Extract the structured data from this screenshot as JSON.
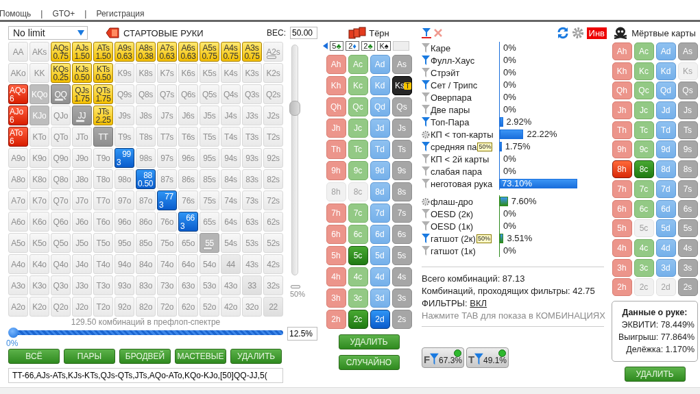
{
  "menu": [
    {
      "kind": "item",
      "label": "Помощь"
    },
    {
      "kind": "separator",
      "label": "|"
    },
    {
      "kind": "item",
      "label": "GTO+"
    },
    {
      "kind": "separator",
      "label": "|"
    },
    {
      "kind": "item",
      "label": "Регистрация"
    }
  ],
  "range_panel": {
    "game_select": "No limit",
    "title": "СТАРТОВЫЕ РУКИ",
    "weight_label": "ВЕС:",
    "weight_value": "50.00",
    "grid": [
      [
        {
          "label": "AA",
          "kind": "none",
          "partial": false
        },
        {
          "label": "AKs",
          "kind": "none",
          "partial": false
        },
        {
          "label": "AQs",
          "weight": "0.75",
          "kind": "gold",
          "partial": false
        },
        {
          "label": "AJs",
          "weight": "1.50",
          "kind": "gold",
          "partial": false
        },
        {
          "label": "ATs",
          "weight": "1.50",
          "kind": "gold",
          "partial": false
        },
        {
          "label": "A9s",
          "weight": "0.63",
          "kind": "gold",
          "partial": false
        },
        {
          "label": "A8s",
          "weight": "0.38",
          "kind": "gold",
          "partial": false
        },
        {
          "label": "A7s",
          "weight": "0.63",
          "kind": "gold",
          "partial": false
        },
        {
          "label": "A6s",
          "weight": "0.63",
          "kind": "gold",
          "partial": false
        },
        {
          "label": "A5s",
          "weight": "0.75",
          "kind": "gold",
          "partial": false
        },
        {
          "label": "A4s",
          "weight": "0.75",
          "kind": "gold",
          "partial": false
        },
        {
          "label": "A3s",
          "weight": "0.75",
          "kind": "gold",
          "partial": false
        },
        {
          "label": "A2s",
          "kind": "none",
          "partial": true
        }
      ],
      [
        {
          "label": "AKo",
          "kind": "none",
          "partial": false
        },
        {
          "label": "KK",
          "kind": "none",
          "partial": false
        },
        {
          "label": "KQs",
          "weight": "0.25",
          "kind": "gold",
          "partial": false
        },
        {
          "label": "KJs",
          "weight": "0.50",
          "kind": "gold",
          "partial": false
        },
        {
          "label": "KTs",
          "weight": "0.50",
          "kind": "gold",
          "partial": false
        },
        {
          "label": "K9s",
          "kind": "none",
          "partial": false
        },
        {
          "label": "K8s",
          "kind": "none",
          "partial": false
        },
        {
          "label": "K7s",
          "kind": "none",
          "partial": false
        },
        {
          "label": "K6s",
          "kind": "none",
          "partial": false
        },
        {
          "label": "K5s",
          "kind": "none",
          "partial": false
        },
        {
          "label": "K4s",
          "kind": "none",
          "partial": false
        },
        {
          "label": "K3s",
          "kind": "none",
          "partial": false
        },
        {
          "label": "K2s",
          "kind": "none",
          "partial": false
        }
      ],
      [
        {
          "label": "AQo",
          "weight": "6",
          "kind": "red",
          "partial": false
        },
        {
          "label": "KQo",
          "kind": "grey",
          "partial": false
        },
        {
          "label": "QQ",
          "kind": "dark",
          "partial": true
        },
        {
          "label": "QJs",
          "weight": "1.75",
          "kind": "gold",
          "partial": false
        },
        {
          "label": "QTs",
          "weight": "1.75",
          "kind": "gold",
          "partial": false
        },
        {
          "label": "Q9s",
          "kind": "none",
          "partial": false
        },
        {
          "label": "Q8s",
          "kind": "none",
          "partial": false
        },
        {
          "label": "Q7s",
          "kind": "none",
          "partial": false
        },
        {
          "label": "Q6s",
          "kind": "none",
          "partial": false
        },
        {
          "label": "Q5s",
          "kind": "none",
          "partial": false
        },
        {
          "label": "Q4s",
          "kind": "none",
          "partial": false
        },
        {
          "label": "Q3s",
          "kind": "none",
          "partial": false
        },
        {
          "label": "Q2s",
          "kind": "none",
          "partial": false
        }
      ],
      [
        {
          "label": "AJo",
          "weight": "6",
          "kind": "red",
          "partial": false
        },
        {
          "label": "KJo",
          "kind": "grey",
          "partial": false
        },
        {
          "label": "QJo",
          "kind": "none",
          "partial": false
        },
        {
          "label": "JJ",
          "kind": "dark",
          "partial": true
        },
        {
          "label": "JTs",
          "weight": "2.25",
          "kind": "gold",
          "partial": false
        },
        {
          "label": "J9s",
          "kind": "none",
          "partial": false
        },
        {
          "label": "J8s",
          "kind": "none",
          "partial": false
        },
        {
          "label": "J7s",
          "kind": "none",
          "partial": false
        },
        {
          "label": "J6s",
          "kind": "none",
          "partial": false
        },
        {
          "label": "J5s",
          "kind": "none",
          "partial": false
        },
        {
          "label": "J4s",
          "kind": "none",
          "partial": false
        },
        {
          "label": "J3s",
          "kind": "none",
          "partial": false
        },
        {
          "label": "J2s",
          "kind": "none",
          "partial": false
        }
      ],
      [
        {
          "label": "ATo",
          "weight": "6",
          "kind": "red",
          "partial": false
        },
        {
          "label": "KTo",
          "kind": "none",
          "partial": false
        },
        {
          "label": "QTo",
          "kind": "none",
          "partial": false
        },
        {
          "label": "JTo",
          "kind": "none",
          "partial": false
        },
        {
          "label": "TT",
          "kind": "dark",
          "partial": false
        },
        {
          "label": "T9s",
          "kind": "none",
          "partial": false
        },
        {
          "label": "T8s",
          "kind": "none",
          "partial": false
        },
        {
          "label": "T7s",
          "kind": "none",
          "partial": false
        },
        {
          "label": "T6s",
          "kind": "none",
          "partial": false
        },
        {
          "label": "T5s",
          "kind": "none",
          "partial": false
        },
        {
          "label": "T4s",
          "kind": "none",
          "partial": false
        },
        {
          "label": "T3s",
          "kind": "none",
          "partial": false
        },
        {
          "label": "T2s",
          "kind": "none",
          "partial": false
        }
      ],
      [
        {
          "label": "A9o",
          "kind": "none",
          "partial": false
        },
        {
          "label": "K9o",
          "kind": "none",
          "partial": false
        },
        {
          "label": "Q9o",
          "kind": "none",
          "partial": false
        },
        {
          "label": "J9o",
          "kind": "none",
          "partial": false
        },
        {
          "label": "T9o",
          "kind": "none",
          "partial": false
        },
        {
          "label": "99",
          "weight": "3",
          "kind": "blue",
          "partial": false
        },
        {
          "label": "98s",
          "kind": "none",
          "partial": false
        },
        {
          "label": "97s",
          "kind": "none",
          "partial": false
        },
        {
          "label": "96s",
          "kind": "none",
          "partial": false
        },
        {
          "label": "95s",
          "kind": "none",
          "partial": false
        },
        {
          "label": "94s",
          "kind": "none",
          "partial": false
        },
        {
          "label": "93s",
          "kind": "none",
          "partial": false
        },
        {
          "label": "92s",
          "kind": "none",
          "partial": false
        }
      ],
      [
        {
          "label": "A8o",
          "kind": "none",
          "partial": false
        },
        {
          "label": "K8o",
          "kind": "none",
          "partial": false
        },
        {
          "label": "Q8o",
          "kind": "none",
          "partial": false
        },
        {
          "label": "J8o",
          "kind": "none",
          "partial": false
        },
        {
          "label": "T8o",
          "kind": "none",
          "partial": false
        },
        {
          "label": "98o",
          "kind": "none",
          "partial": false
        },
        {
          "label": "88",
          "weight": "0.50",
          "kind": "blue",
          "partial": false
        },
        {
          "label": "87s",
          "kind": "none",
          "partial": false
        },
        {
          "label": "86s",
          "kind": "none",
          "partial": false
        },
        {
          "label": "85s",
          "kind": "none",
          "partial": false
        },
        {
          "label": "84s",
          "kind": "none",
          "partial": false
        },
        {
          "label": "83s",
          "kind": "none",
          "partial": false
        },
        {
          "label": "82s",
          "kind": "none",
          "partial": false
        }
      ],
      [
        {
          "label": "A7o",
          "kind": "none",
          "partial": false
        },
        {
          "label": "K7o",
          "kind": "none",
          "partial": false
        },
        {
          "label": "Q7o",
          "kind": "none",
          "partial": false
        },
        {
          "label": "J7o",
          "kind": "none",
          "partial": false
        },
        {
          "label": "T7o",
          "kind": "none",
          "partial": false
        },
        {
          "label": "97o",
          "kind": "none",
          "partial": false
        },
        {
          "label": "87o",
          "kind": "none",
          "partial": false
        },
        {
          "label": "77",
          "weight": "3",
          "kind": "blue",
          "partial": false
        },
        {
          "label": "76s",
          "kind": "none",
          "partial": false
        },
        {
          "label": "75s",
          "kind": "none",
          "partial": false
        },
        {
          "label": "74s",
          "kind": "none",
          "partial": false
        },
        {
          "label": "73s",
          "kind": "none",
          "partial": false
        },
        {
          "label": "72s",
          "kind": "none",
          "partial": false
        }
      ],
      [
        {
          "label": "A6o",
          "kind": "none",
          "partial": false
        },
        {
          "label": "K6o",
          "kind": "none",
          "partial": false
        },
        {
          "label": "Q6o",
          "kind": "none",
          "partial": false
        },
        {
          "label": "J6o",
          "kind": "none",
          "partial": false
        },
        {
          "label": "T6o",
          "kind": "none",
          "partial": false
        },
        {
          "label": "96o",
          "kind": "none",
          "partial": false
        },
        {
          "label": "86o",
          "kind": "none",
          "partial": false
        },
        {
          "label": "76o",
          "kind": "none",
          "partial": false
        },
        {
          "label": "66",
          "weight": "3",
          "kind": "blue",
          "partial": false
        },
        {
          "label": "65s",
          "kind": "none",
          "partial": false
        },
        {
          "label": "64s",
          "kind": "none",
          "partial": false
        },
        {
          "label": "63s",
          "kind": "none",
          "partial": false
        },
        {
          "label": "62s",
          "kind": "none",
          "partial": false
        }
      ],
      [
        {
          "label": "A5o",
          "kind": "none",
          "partial": false
        },
        {
          "label": "K5o",
          "kind": "none",
          "partial": false
        },
        {
          "label": "Q5o",
          "kind": "none",
          "partial": false
        },
        {
          "label": "J5o",
          "kind": "none",
          "partial": false
        },
        {
          "label": "T5o",
          "kind": "none",
          "partial": false
        },
        {
          "label": "95o",
          "kind": "none",
          "partial": false
        },
        {
          "label": "85o",
          "kind": "none",
          "partial": false
        },
        {
          "label": "75o",
          "kind": "none",
          "partial": false
        },
        {
          "label": "65o",
          "kind": "none",
          "partial": false
        },
        {
          "label": "55",
          "kind": "light",
          "partial": true
        },
        {
          "label": "54s",
          "kind": "none",
          "partial": false
        },
        {
          "label": "53s",
          "kind": "none",
          "partial": false
        },
        {
          "label": "52s",
          "kind": "none",
          "partial": false
        }
      ],
      [
        {
          "label": "A4o",
          "kind": "none",
          "partial": false
        },
        {
          "label": "K4o",
          "kind": "none",
          "partial": false
        },
        {
          "label": "Q4o",
          "kind": "none",
          "partial": false
        },
        {
          "label": "J4o",
          "kind": "none",
          "partial": false
        },
        {
          "label": "T4o",
          "kind": "none",
          "partial": false
        },
        {
          "label": "94o",
          "kind": "none",
          "partial": false
        },
        {
          "label": "84o",
          "kind": "none",
          "partial": false
        },
        {
          "label": "74o",
          "kind": "none",
          "partial": false
        },
        {
          "label": "64o",
          "kind": "none",
          "partial": false
        },
        {
          "label": "54o",
          "kind": "none",
          "partial": false
        },
        {
          "label": "44",
          "kind": "pair",
          "partial": false
        },
        {
          "label": "43s",
          "kind": "none",
          "partial": false
        },
        {
          "label": "42s",
          "kind": "none",
          "partial": false
        }
      ],
      [
        {
          "label": "A3o",
          "kind": "none",
          "partial": false
        },
        {
          "label": "K3o",
          "kind": "none",
          "partial": false
        },
        {
          "label": "Q3o",
          "kind": "none",
          "partial": false
        },
        {
          "label": "J3o",
          "kind": "none",
          "partial": false
        },
        {
          "label": "T3o",
          "kind": "none",
          "partial": false
        },
        {
          "label": "93o",
          "kind": "none",
          "partial": false
        },
        {
          "label": "83o",
          "kind": "none",
          "partial": false
        },
        {
          "label": "73o",
          "kind": "none",
          "partial": false
        },
        {
          "label": "63o",
          "kind": "none",
          "partial": false
        },
        {
          "label": "53o",
          "kind": "none",
          "partial": false
        },
        {
          "label": "43o",
          "kind": "none",
          "partial": false
        },
        {
          "label": "33",
          "kind": "pair",
          "partial": false
        },
        {
          "label": "32s",
          "kind": "none",
          "partial": false
        }
      ],
      [
        {
          "label": "A2o",
          "kind": "none",
          "partial": false
        },
        {
          "label": "K2o",
          "kind": "none",
          "partial": false
        },
        {
          "label": "Q2o",
          "kind": "none",
          "partial": false
        },
        {
          "label": "J2o",
          "kind": "none",
          "partial": false
        },
        {
          "label": "T2o",
          "kind": "none",
          "partial": false
        },
        {
          "label": "92o",
          "kind": "none",
          "partial": false
        },
        {
          "label": "82o",
          "kind": "none",
          "partial": false
        },
        {
          "label": "72o",
          "kind": "none",
          "partial": false
        },
        {
          "label": "62o",
          "kind": "none",
          "partial": false
        },
        {
          "label": "52o",
          "kind": "none",
          "partial": false
        },
        {
          "label": "42o",
          "kind": "none",
          "partial": false
        },
        {
          "label": "32o",
          "kind": "none",
          "partial": false
        },
        {
          "label": "22",
          "kind": "pair",
          "partial": false
        }
      ]
    ],
    "weight_slider": {
      "level": 0.72,
      "mark_label": "50%"
    },
    "combos_caption": "129.50 комбинаций в префлоп-спектре",
    "range_slider": {
      "level": 0,
      "min_label": "0%"
    },
    "percent_value": "12.5%",
    "buttons": [
      "ВСЁ",
      "ПАРЫ",
      "БРОДВЕЙ",
      "МАСТЕВЫЕ",
      "УДАЛИТЬ"
    ],
    "range_text": "TT-66,AJs-ATs,KJs-KTs,QJs-QTs,JTs,AQo-ATo,KQo-KJo,[50]QQ-JJ,5("
  },
  "board_panel": {
    "title": "Тёрн",
    "board": [
      {
        "kind": "c",
        "rank": "5",
        "suit": "♣"
      },
      {
        "kind": "d",
        "rank": "2",
        "suit": "♦"
      },
      {
        "kind": "c",
        "rank": "2",
        "suit": "♣"
      },
      {
        "kind": "s",
        "rank": "K",
        "suit": "♠"
      },
      {
        "kind": "empty"
      }
    ],
    "cards": [
      {
        "label": "Ah",
        "kind": "h",
        "selected": false,
        "disabled": false
      },
      {
        "label": "Ac",
        "kind": "c",
        "selected": false,
        "disabled": false
      },
      {
        "label": "Ad",
        "kind": "d",
        "selected": false,
        "disabled": false
      },
      {
        "label": "As",
        "kind": "s",
        "selected": false,
        "disabled": false
      },
      {
        "label": "Kh",
        "kind": "h",
        "selected": false,
        "disabled": false
      },
      {
        "label": "Kc",
        "kind": "c",
        "selected": false,
        "disabled": false
      },
      {
        "label": "Kd",
        "kind": "d",
        "selected": false,
        "disabled": false
      },
      {
        "label": "Ks",
        "kind": "s",
        "selected": true,
        "disabled": false,
        "badge": "T"
      },
      {
        "label": "Qh",
        "kind": "h",
        "selected": false,
        "disabled": false
      },
      {
        "label": "Qc",
        "kind": "c",
        "selected": false,
        "disabled": false
      },
      {
        "label": "Qd",
        "kind": "d",
        "selected": false,
        "disabled": false
      },
      {
        "label": "Qs",
        "kind": "s",
        "selected": false,
        "disabled": false
      },
      {
        "label": "Jh",
        "kind": "h",
        "selected": false,
        "disabled": false
      },
      {
        "label": "Jc",
        "kind": "c",
        "selected": false,
        "disabled": false
      },
      {
        "label": "Jd",
        "kind": "d",
        "selected": false,
        "disabled": false
      },
      {
        "label": "Js",
        "kind": "s",
        "selected": false,
        "disabled": false
      },
      {
        "label": "Th",
        "kind": "h",
        "selected": false,
        "disabled": false
      },
      {
        "label": "Tc",
        "kind": "c",
        "selected": false,
        "disabled": false
      },
      {
        "label": "Td",
        "kind": "d",
        "selected": false,
        "disabled": false
      },
      {
        "label": "Ts",
        "kind": "s",
        "selected": false,
        "disabled": false
      },
      {
        "label": "9h",
        "kind": "h",
        "selected": false,
        "disabled": false
      },
      {
        "label": "9c",
        "kind": "c",
        "selected": false,
        "disabled": false
      },
      {
        "label": "9d",
        "kind": "d",
        "selected": false,
        "disabled": false
      },
      {
        "label": "9s",
        "kind": "s",
        "selected": false,
        "disabled": false
      },
      {
        "label": "8h",
        "kind": "h",
        "selected": false,
        "disabled": true
      },
      {
        "label": "8c",
        "kind": "c",
        "selected": false,
        "disabled": true
      },
      {
        "label": "8d",
        "kind": "d",
        "selected": false,
        "disabled": false
      },
      {
        "label": "8s",
        "kind": "s",
        "selected": false,
        "disabled": false
      },
      {
        "label": "7h",
        "kind": "h",
        "selected": false,
        "disabled": false
      },
      {
        "label": "7c",
        "kind": "c",
        "selected": false,
        "disabled": false
      },
      {
        "label": "7d",
        "kind": "d",
        "selected": false,
        "disabled": false
      },
      {
        "label": "7s",
        "kind": "s",
        "selected": false,
        "disabled": false
      },
      {
        "label": "6h",
        "kind": "h",
        "selected": false,
        "disabled": false
      },
      {
        "label": "6c",
        "kind": "c",
        "selected": false,
        "disabled": false
      },
      {
        "label": "6d",
        "kind": "d",
        "selected": false,
        "disabled": false
      },
      {
        "label": "6s",
        "kind": "s",
        "selected": false,
        "disabled": false
      },
      {
        "label": "5h",
        "kind": "h",
        "selected": false,
        "disabled": false
      },
      {
        "label": "5c",
        "kind": "c",
        "selected": true,
        "disabled": false
      },
      {
        "label": "5d",
        "kind": "d",
        "selected": false,
        "disabled": false
      },
      {
        "label": "5s",
        "kind": "s",
        "selected": false,
        "disabled": false
      },
      {
        "label": "4h",
        "kind": "h",
        "selected": false,
        "disabled": false
      },
      {
        "label": "4c",
        "kind": "c",
        "selected": false,
        "disabled": false
      },
      {
        "label": "4d",
        "kind": "d",
        "selected": false,
        "disabled": false
      },
      {
        "label": "4s",
        "kind": "s",
        "selected": false,
        "disabled": false
      },
      {
        "label": "3h",
        "kind": "h",
        "selected": false,
        "disabled": false
      },
      {
        "label": "3c",
        "kind": "c",
        "selected": false,
        "disabled": false
      },
      {
        "label": "3d",
        "kind": "d",
        "selected": false,
        "disabled": false
      },
      {
        "label": "3s",
        "kind": "s",
        "selected": false,
        "disabled": false
      },
      {
        "label": "2h",
        "kind": "h",
        "selected": false,
        "disabled": false
      },
      {
        "label": "2c",
        "kind": "c",
        "selected": true,
        "disabled": false
      },
      {
        "label": "2d",
        "kind": "d",
        "selected": true,
        "disabled": false
      },
      {
        "label": "2s",
        "kind": "s",
        "selected": false,
        "disabled": false
      }
    ],
    "buttons": [
      "УДАЛИТЬ",
      "СЛУЧАЙНО"
    ]
  },
  "stats_panel": {
    "invert_label": "Инв",
    "groups": [
      {
        "kind": "made",
        "rows": [
          {
            "kind": "filter",
            "active": false,
            "label": "Каре",
            "value": "0%"
          },
          {
            "kind": "filter",
            "active": true,
            "label": "Фулл-Хаус",
            "value": "0%"
          },
          {
            "kind": "filter",
            "active": false,
            "label": "Стрэйт",
            "value": "0%"
          },
          {
            "kind": "filter",
            "active": true,
            "label": "Сет / Трипс",
            "value": "0%"
          },
          {
            "kind": "filter",
            "active": false,
            "label": "Оверпара",
            "value": "0%"
          },
          {
            "kind": "filter",
            "active": false,
            "label": "Две пары",
            "value": "0%"
          },
          {
            "kind": "filter",
            "active": true,
            "label": "Топ-Пара",
            "level": 0.0292,
            "value": "2.92%"
          },
          {
            "kind": "gear",
            "active": false,
            "label": "КП < топ-карты",
            "level": 0.2222,
            "value": "22.22%"
          },
          {
            "kind": "filter",
            "active": true,
            "label": "средняя па",
            "badge": "50%",
            "level": 0.0175,
            "value": "1.75%"
          },
          {
            "kind": "filter",
            "active": false,
            "label": "КП < 2й карты",
            "value": "0%"
          },
          {
            "kind": "filter",
            "active": false,
            "label": "слабая пара",
            "value": "0%"
          },
          {
            "kind": "filter",
            "active": false,
            "label": "неготовая рука",
            "level": 0.731,
            "value": "73.10%"
          }
        ]
      },
      {
        "kind": "draw",
        "rows": [
          {
            "kind": "gear",
            "active": false,
            "label": "флаш-дро",
            "level": 0.076,
            "value": "7.60%"
          },
          {
            "kind": "filter",
            "active": false,
            "label": "OESD (2к)",
            "value": "0%"
          },
          {
            "kind": "filter",
            "active": false,
            "label": "OESD (1к)",
            "value": "0%"
          },
          {
            "kind": "filter",
            "active": true,
            "label": "гатшот (2к)",
            "badge": "50%",
            "level": 0.0351,
            "value": "3.51%"
          },
          {
            "kind": "filter",
            "active": false,
            "label": "гатшот (1к)",
            "value": "0%"
          }
        ]
      }
    ],
    "total_combos": "Всего комбинаций: 87.13",
    "passing_combos": "Комбинаций, проходящих фильтры: 42.75",
    "filters_label": "ФИЛЬТРЫ:",
    "filters_link": "ВКЛ",
    "hint": "Нажмите TAB для показа в КОМБИНАЦИЯХ",
    "toggles": [
      {
        "letter": "F",
        "value": "67.3%",
        "on": true
      },
      {
        "letter": "T",
        "value": "49.1%",
        "on": true
      }
    ]
  },
  "dead_panel": {
    "title": "Мёртвые карты",
    "cards": [
      {
        "label": "Ah",
        "kind": "h",
        "selected": false,
        "disabled": false
      },
      {
        "label": "Ac",
        "kind": "c",
        "selected": false,
        "disabled": false
      },
      {
        "label": "Ad",
        "kind": "d",
        "selected": false,
        "disabled": false
      },
      {
        "label": "As",
        "kind": "s",
        "selected": false,
        "disabled": false
      },
      {
        "label": "Kh",
        "kind": "h",
        "selected": false,
        "disabled": false
      },
      {
        "label": "Kc",
        "kind": "c",
        "selected": false,
        "disabled": false
      },
      {
        "label": "Kd",
        "kind": "d",
        "selected": false,
        "disabled": false
      },
      {
        "label": "Ks",
        "kind": "s",
        "selected": false,
        "disabled": true
      },
      {
        "label": "Qh",
        "kind": "h",
        "selected": false,
        "disabled": false
      },
      {
        "label": "Qc",
        "kind": "c",
        "selected": false,
        "disabled": false
      },
      {
        "label": "Qd",
        "kind": "d",
        "selected": false,
        "disabled": false
      },
      {
        "label": "Qs",
        "kind": "s",
        "selected": false,
        "disabled": false
      },
      {
        "label": "Jh",
        "kind": "h",
        "selected": false,
        "disabled": false
      },
      {
        "label": "Jc",
        "kind": "c",
        "selected": false,
        "disabled": false
      },
      {
        "label": "Jd",
        "kind": "d",
        "selected": false,
        "disabled": false
      },
      {
        "label": "Js",
        "kind": "s",
        "selected": false,
        "disabled": false
      },
      {
        "label": "Th",
        "kind": "h",
        "selected": false,
        "disabled": false
      },
      {
        "label": "Tc",
        "kind": "c",
        "selected": false,
        "disabled": false
      },
      {
        "label": "Td",
        "kind": "d",
        "selected": false,
        "disabled": false
      },
      {
        "label": "Ts",
        "kind": "s",
        "selected": false,
        "disabled": false
      },
      {
        "label": "9h",
        "kind": "h",
        "selected": false,
        "disabled": false
      },
      {
        "label": "9c",
        "kind": "c",
        "selected": false,
        "disabled": false
      },
      {
        "label": "9d",
        "kind": "d",
        "selected": false,
        "disabled": false
      },
      {
        "label": "9s",
        "kind": "s",
        "selected": false,
        "disabled": false
      },
      {
        "label": "8h",
        "kind": "h",
        "selected": true,
        "disabled": false
      },
      {
        "label": "8c",
        "kind": "c",
        "selected": true,
        "disabled": false
      },
      {
        "label": "8d",
        "kind": "d",
        "selected": false,
        "disabled": false
      },
      {
        "label": "8s",
        "kind": "s",
        "selected": false,
        "disabled": false
      },
      {
        "label": "7h",
        "kind": "h",
        "selected": false,
        "disabled": false
      },
      {
        "label": "7c",
        "kind": "c",
        "selected": false,
        "disabled": false
      },
      {
        "label": "7d",
        "kind": "d",
        "selected": false,
        "disabled": false
      },
      {
        "label": "7s",
        "kind": "s",
        "selected": false,
        "disabled": false
      },
      {
        "label": "6h",
        "kind": "h",
        "selected": false,
        "disabled": false
      },
      {
        "label": "6c",
        "kind": "c",
        "selected": false,
        "disabled": false
      },
      {
        "label": "6d",
        "kind": "d",
        "selected": false,
        "disabled": false
      },
      {
        "label": "6s",
        "kind": "s",
        "selected": false,
        "disabled": false
      },
      {
        "label": "5h",
        "kind": "h",
        "selected": false,
        "disabled": false
      },
      {
        "label": "5c",
        "kind": "c",
        "selected": false,
        "disabled": true
      },
      {
        "label": "5d",
        "kind": "d",
        "selected": false,
        "disabled": false
      },
      {
        "label": "5s",
        "kind": "s",
        "selected": false,
        "disabled": false
      },
      {
        "label": "4h",
        "kind": "h",
        "selected": false,
        "disabled": false
      },
      {
        "label": "4c",
        "kind": "c",
        "selected": false,
        "disabled": false
      },
      {
        "label": "4d",
        "kind": "d",
        "selected": false,
        "disabled": false
      },
      {
        "label": "4s",
        "kind": "s",
        "selected": false,
        "disabled": false
      },
      {
        "label": "3h",
        "kind": "h",
        "selected": false,
        "disabled": false
      },
      {
        "label": "3c",
        "kind": "c",
        "selected": false,
        "disabled": false
      },
      {
        "label": "3d",
        "kind": "d",
        "selected": false,
        "disabled": false
      },
      {
        "label": "3s",
        "kind": "s",
        "selected": false,
        "disabled": false
      },
      {
        "label": "2h",
        "kind": "h",
        "selected": false,
        "disabled": false
      },
      {
        "label": "2c",
        "kind": "c",
        "selected": false,
        "disabled": true
      },
      {
        "label": "2d",
        "kind": "d",
        "selected": false,
        "disabled": true
      },
      {
        "label": "2s",
        "kind": "s",
        "selected": false,
        "disabled": false
      }
    ],
    "hand_info": {
      "title": "Данные о руке:",
      "lines": [
        "ЭКВИТИ: 78.449%",
        "Выигрыш: 77.864%",
        "Делёжка: 1.170%"
      ]
    },
    "button": "УДАЛИТЬ"
  }
}
